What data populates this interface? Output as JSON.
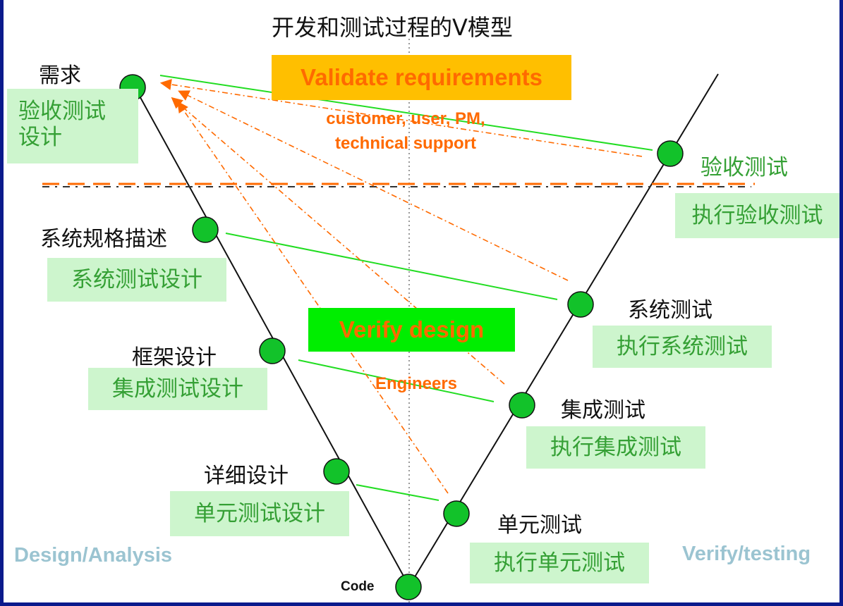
{
  "title": "开发和测试过程的V模型",
  "validate_box": "Validate  requirements",
  "validate_note": [
    "customer,   user, PM,",
    "technical  support"
  ],
  "verify_box": "Verify design",
  "verify_note": "Engineers",
  "design_corner": "Design/Analysis",
  "verify_corner": "Verify/testing",
  "code_label": "Code",
  "left_stages": [
    {
      "label": "需求",
      "box": "验收测试\n设计"
    },
    {
      "label": "系统规格描述",
      "box": "系统测试设计"
    },
    {
      "label": "框架设计",
      "box": "集成测试设计"
    },
    {
      "label": "详细设计",
      "box": "单元测试设计"
    }
  ],
  "right_stages": [
    {
      "label": "验收测试",
      "box": "执行验收测试"
    },
    {
      "label": "系统测试",
      "box": "执行系统测试"
    },
    {
      "label": "集成测试",
      "box": "执行集成测试"
    },
    {
      "label": "单元测试",
      "box": "执行单元测试"
    }
  ],
  "colors": {
    "frame": "#0b1a8c",
    "node": "#12c22a",
    "link": "#22dd22",
    "arrow": "#ff6a00",
    "green_text": "#35a035",
    "green_box_bg": "#cdf5cd"
  }
}
